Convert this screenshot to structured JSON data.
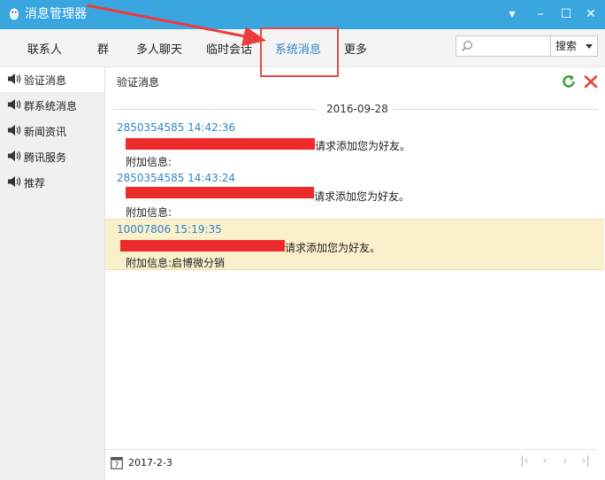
{
  "window": {
    "title": "消息管理器",
    "controls": {
      "menu": "▾",
      "minimize": "–",
      "maximize": "☐",
      "close": "✕"
    }
  },
  "tabs": [
    {
      "label": "联系人",
      "active": false
    },
    {
      "label": "群",
      "active": false
    },
    {
      "label": "多人聊天",
      "active": false
    },
    {
      "label": "临时会话",
      "active": false
    },
    {
      "label": "系统消息",
      "active": true
    },
    {
      "label": "更多",
      "active": false
    }
  ],
  "search": {
    "placeholder": "",
    "button_label": "搜索"
  },
  "sidebar": {
    "items": [
      {
        "label": "验证消息",
        "active": true
      },
      {
        "label": "群系统消息",
        "active": false
      },
      {
        "label": "新闻资讯",
        "active": false
      },
      {
        "label": "腾讯服务",
        "active": false
      },
      {
        "label": "推荐",
        "active": false
      }
    ]
  },
  "main": {
    "title": "验证消息",
    "date_separator": "2016-09-28",
    "messages": [
      {
        "header": "2850354585 14:42:36",
        "request_text": "请求添加您为好友。",
        "extra_label": "附加信息:",
        "highlighted": false
      },
      {
        "header": "2850354585 14:43:24",
        "request_text": "请求添加您为好友。",
        "extra_label": "附加信息:",
        "highlighted": false
      },
      {
        "header": "10007806 15:19:35",
        "request_text": "请求添加您为好友。",
        "extra_label": "附加信息:启博微分销",
        "highlighted": true
      }
    ]
  },
  "footer": {
    "date": "2017-2-3",
    "pager": {
      "first": "|‹",
      "prev": "‹",
      "next": "›",
      "last": "›|"
    }
  },
  "icons": {
    "app": "qq-penguin-icon",
    "refresh": "refresh-icon",
    "delete": "delete-icon",
    "speaker": "speaker-icon",
    "calendar": "calendar-icon"
  },
  "colors": {
    "titlebar": "#3aa6e0",
    "accent": "#2f86c8",
    "highlight_row": "#fbf0cc",
    "annotation": "#e64a4a",
    "redaction": "#ee2b2b"
  }
}
